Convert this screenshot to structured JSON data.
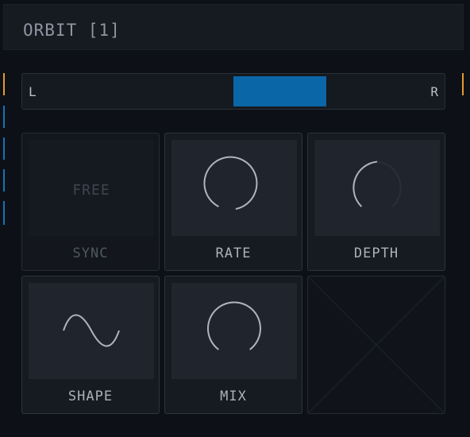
{
  "header": {
    "title": "ORBIT [1]"
  },
  "pan": {
    "left_label": "L",
    "right_label": "R",
    "fill_start": 0.5,
    "fill_end": 0.72
  },
  "colors": {
    "accent_blue": "#0b66a8",
    "marker_orange": "#e39b2c",
    "marker_blue": "#1672b6",
    "knob_stroke": "#aeb5bd"
  },
  "cells": {
    "sync": {
      "label": "SYNC",
      "value": "FREE"
    },
    "rate": {
      "label": "RATE"
    },
    "depth": {
      "label": "DEPTH"
    },
    "shape": {
      "label": "SHAPE",
      "icon": "sine-wave-icon"
    },
    "mix": {
      "label": "MIX"
    }
  }
}
